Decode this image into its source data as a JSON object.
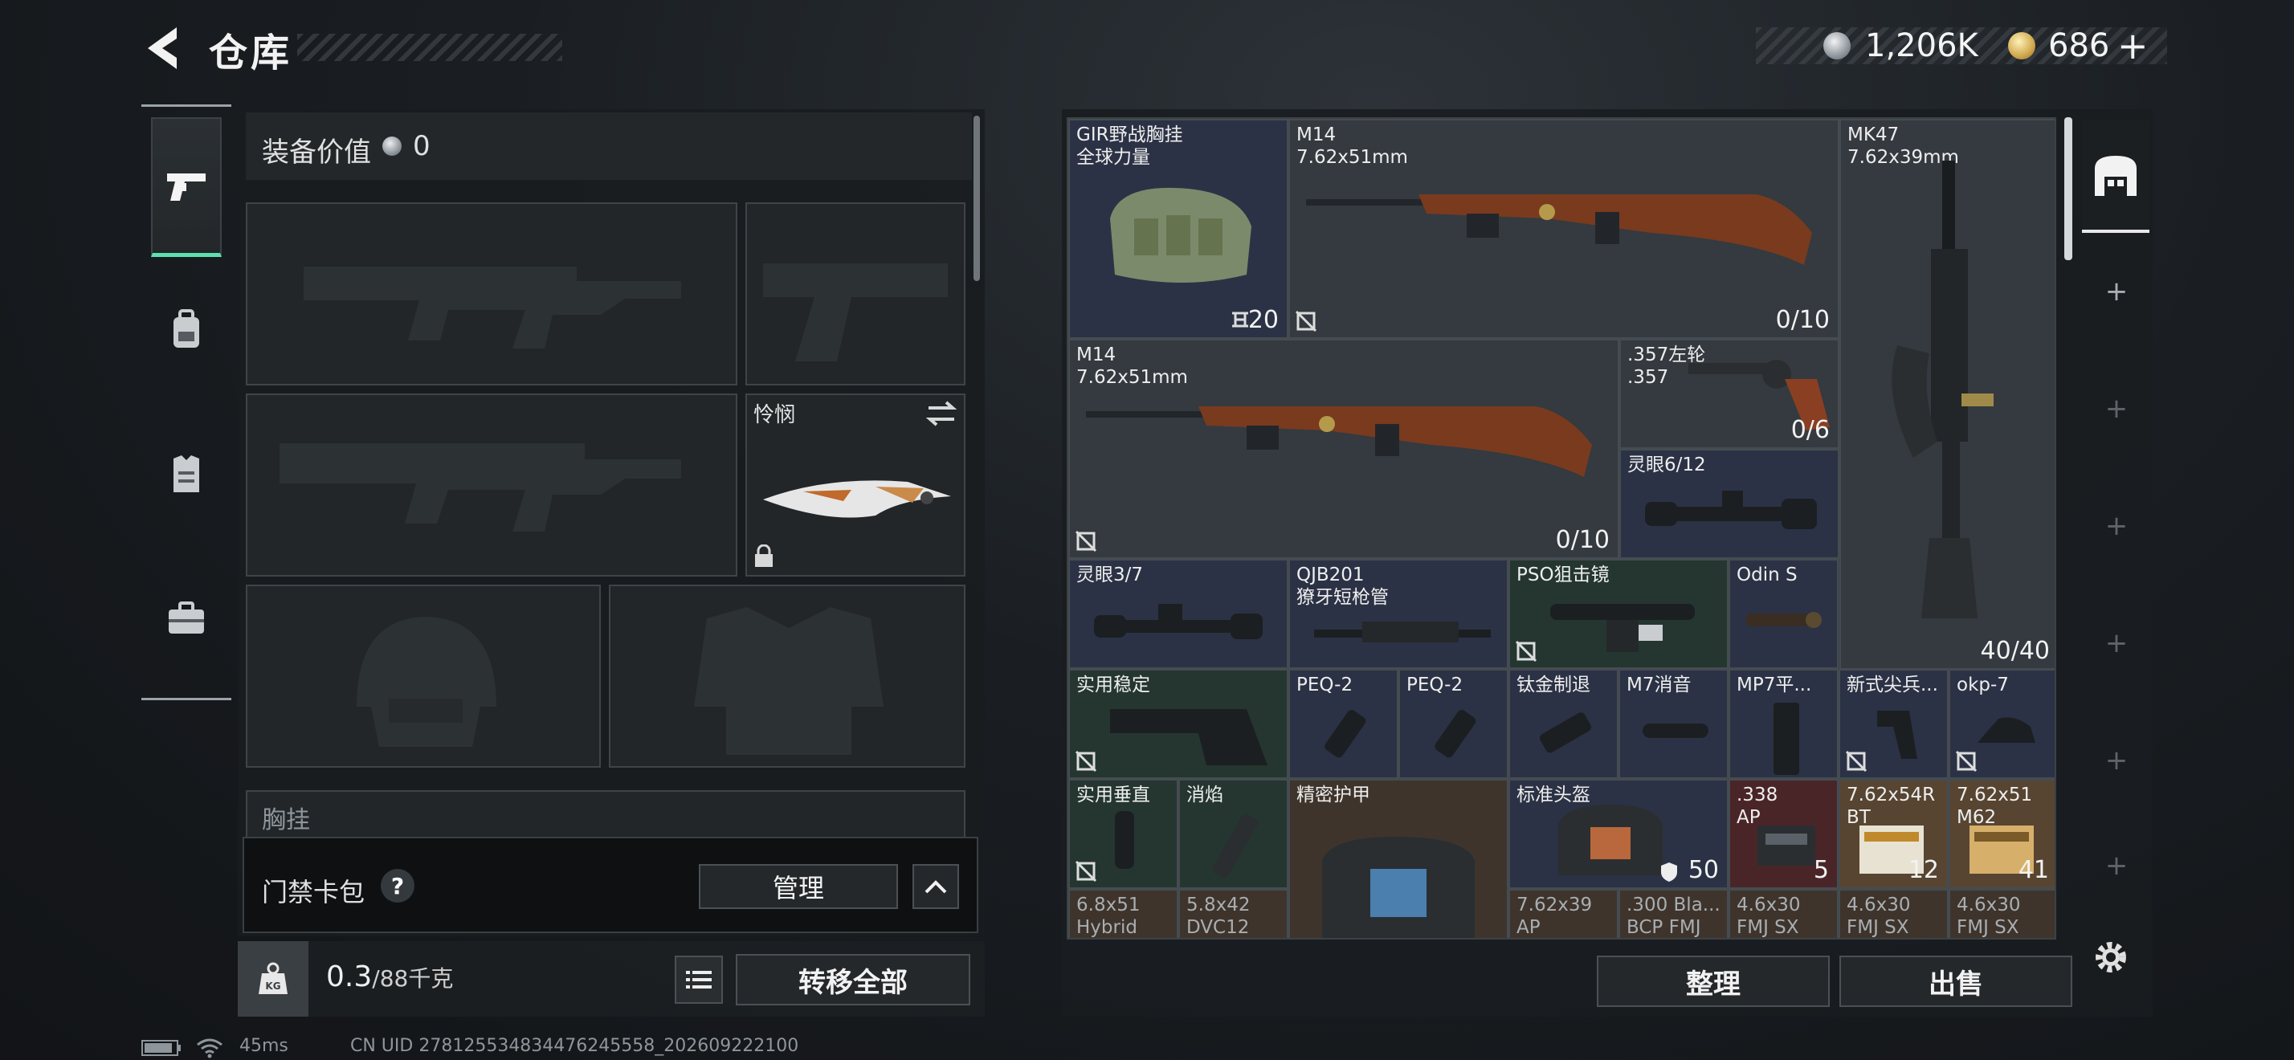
{
  "header": {
    "title": "仓库",
    "back_icon": "back-arrow-icon",
    "currency": {
      "silver": "1,206K",
      "gold": "686",
      "gold_plus": "+"
    }
  },
  "left_rail": {
    "tabs": [
      "pistol-icon",
      "backpack-icon",
      "armor-vest-icon",
      "briefcase-icon"
    ],
    "active": 0
  },
  "loadout": {
    "equip_value_label": "装备价值",
    "equip_value": "0",
    "melee_name": "怜悯",
    "chest_label": "胸挂",
    "keycard_label": "门禁卡包",
    "keycard_help": "?",
    "manage_label": "管理",
    "weight_value": "0.3",
    "weight_unit": "/88千克",
    "transfer_all_label": "转移全部"
  },
  "inventory": {
    "items": [
      {
        "id": "gir-rig",
        "name": "GIR野战胸挂",
        "sub": "全球力量",
        "count": "20",
        "color": "blue"
      },
      {
        "id": "m14-a",
        "name": "M14",
        "sub": "7.62x51mm",
        "count": "0/10",
        "color": "gray"
      },
      {
        "id": "mk47",
        "name": "MK47",
        "sub": "7.62x39mm",
        "count": "40/40",
        "color": "gray"
      },
      {
        "id": "m14-b",
        "name": "M14",
        "sub": "7.62x51mm",
        "count": "0/10",
        "color": "gray"
      },
      {
        "id": "revolver",
        "name": ".357左轮",
        "sub": ".357",
        "count": "0/6",
        "color": "gray"
      },
      {
        "id": "scope-612",
        "name": "灵眼6/12",
        "sub": "",
        "count": "",
        "color": "blue"
      },
      {
        "id": "scope-37",
        "name": "灵眼3/7",
        "sub": "",
        "count": "",
        "color": "blue"
      },
      {
        "id": "qjb201",
        "name": "QJB201",
        "sub": "獠牙短枪管",
        "count": "",
        "color": "blue"
      },
      {
        "id": "pso",
        "name": "PSO狙击镜",
        "sub": "",
        "count": "",
        "color": "green"
      },
      {
        "id": "odin",
        "name": "Odin S",
        "sub": "",
        "count": "",
        "color": "blue"
      },
      {
        "id": "stock",
        "name": "实用稳定",
        "sub": "",
        "count": "",
        "color": "green"
      },
      {
        "id": "peq-a",
        "name": "PEQ-2",
        "sub": "",
        "count": "",
        "color": "blue"
      },
      {
        "id": "peq-b",
        "name": "PEQ-2",
        "sub": "",
        "count": "",
        "color": "blue"
      },
      {
        "id": "brake",
        "name": "钛金制退",
        "sub": "",
        "count": "",
        "color": "blue"
      },
      {
        "id": "m7sup",
        "name": "M7消音",
        "sub": "",
        "count": "",
        "color": "blue"
      },
      {
        "id": "mp7mag",
        "name": "MP7平...",
        "sub": "",
        "count": "",
        "color": "blue"
      },
      {
        "id": "grip-new",
        "name": "新式尖兵...",
        "sub": "",
        "count": "",
        "color": "blue"
      },
      {
        "id": "okp",
        "name": "okp-7",
        "sub": "",
        "count": "",
        "color": "blue"
      },
      {
        "id": "vgrip",
        "name": "实用垂直",
        "sub": "",
        "count": "",
        "color": "green"
      },
      {
        "id": "flash",
        "name": "消焰",
        "sub": "",
        "count": "",
        "color": "green"
      },
      {
        "id": "armor",
        "name": "精密护甲",
        "sub": "",
        "count": "",
        "color": "brown"
      },
      {
        "id": "helmet",
        "name": "标准头盔",
        "sub": "",
        "count": "50",
        "color": "blue"
      },
      {
        "id": "ammo338",
        "name": ".338",
        "sub": "AP",
        "count": "5",
        "color": "red"
      },
      {
        "id": "ammo762r",
        "name": "7.62x54R",
        "sub": "BT",
        "count": "12",
        "color": "gold"
      },
      {
        "id": "ammo76251",
        "name": "7.62x51",
        "sub": "M62",
        "count": "41",
        "color": "gold"
      },
      {
        "id": "a68",
        "name": "6.8x51",
        "sub": "Hybrid",
        "count": "",
        "color": "brown"
      },
      {
        "id": "a58",
        "name": "5.8x42",
        "sub": "DVC12",
        "count": "",
        "color": "brown"
      },
      {
        "id": "a76239",
        "name": "7.62x39",
        "sub": "AP",
        "count": "",
        "color": "brown"
      },
      {
        "id": "a300",
        "name": ".300 Bla...",
        "sub": "BCP FMJ",
        "count": "",
        "color": "brown"
      },
      {
        "id": "a46a",
        "name": "4.6x30",
        "sub": "FMJ SX",
        "count": "",
        "color": "brown"
      },
      {
        "id": "a46b",
        "name": "4.6x30",
        "sub": "FMJ SX",
        "count": "",
        "color": "brown"
      },
      {
        "id": "a46c",
        "name": "4.6x30",
        "sub": "FMJ SX",
        "count": "",
        "color": "brown"
      }
    ],
    "sort_label": "整理",
    "sell_label": "出售"
  },
  "right_rail": {
    "top_icon": "stash-icon",
    "plus_slots": [
      "+",
      "+",
      "+",
      "+",
      "+",
      "+"
    ]
  },
  "status": {
    "ping": "45ms",
    "uid": "CN UID 278125534834476245558_202609222100"
  }
}
